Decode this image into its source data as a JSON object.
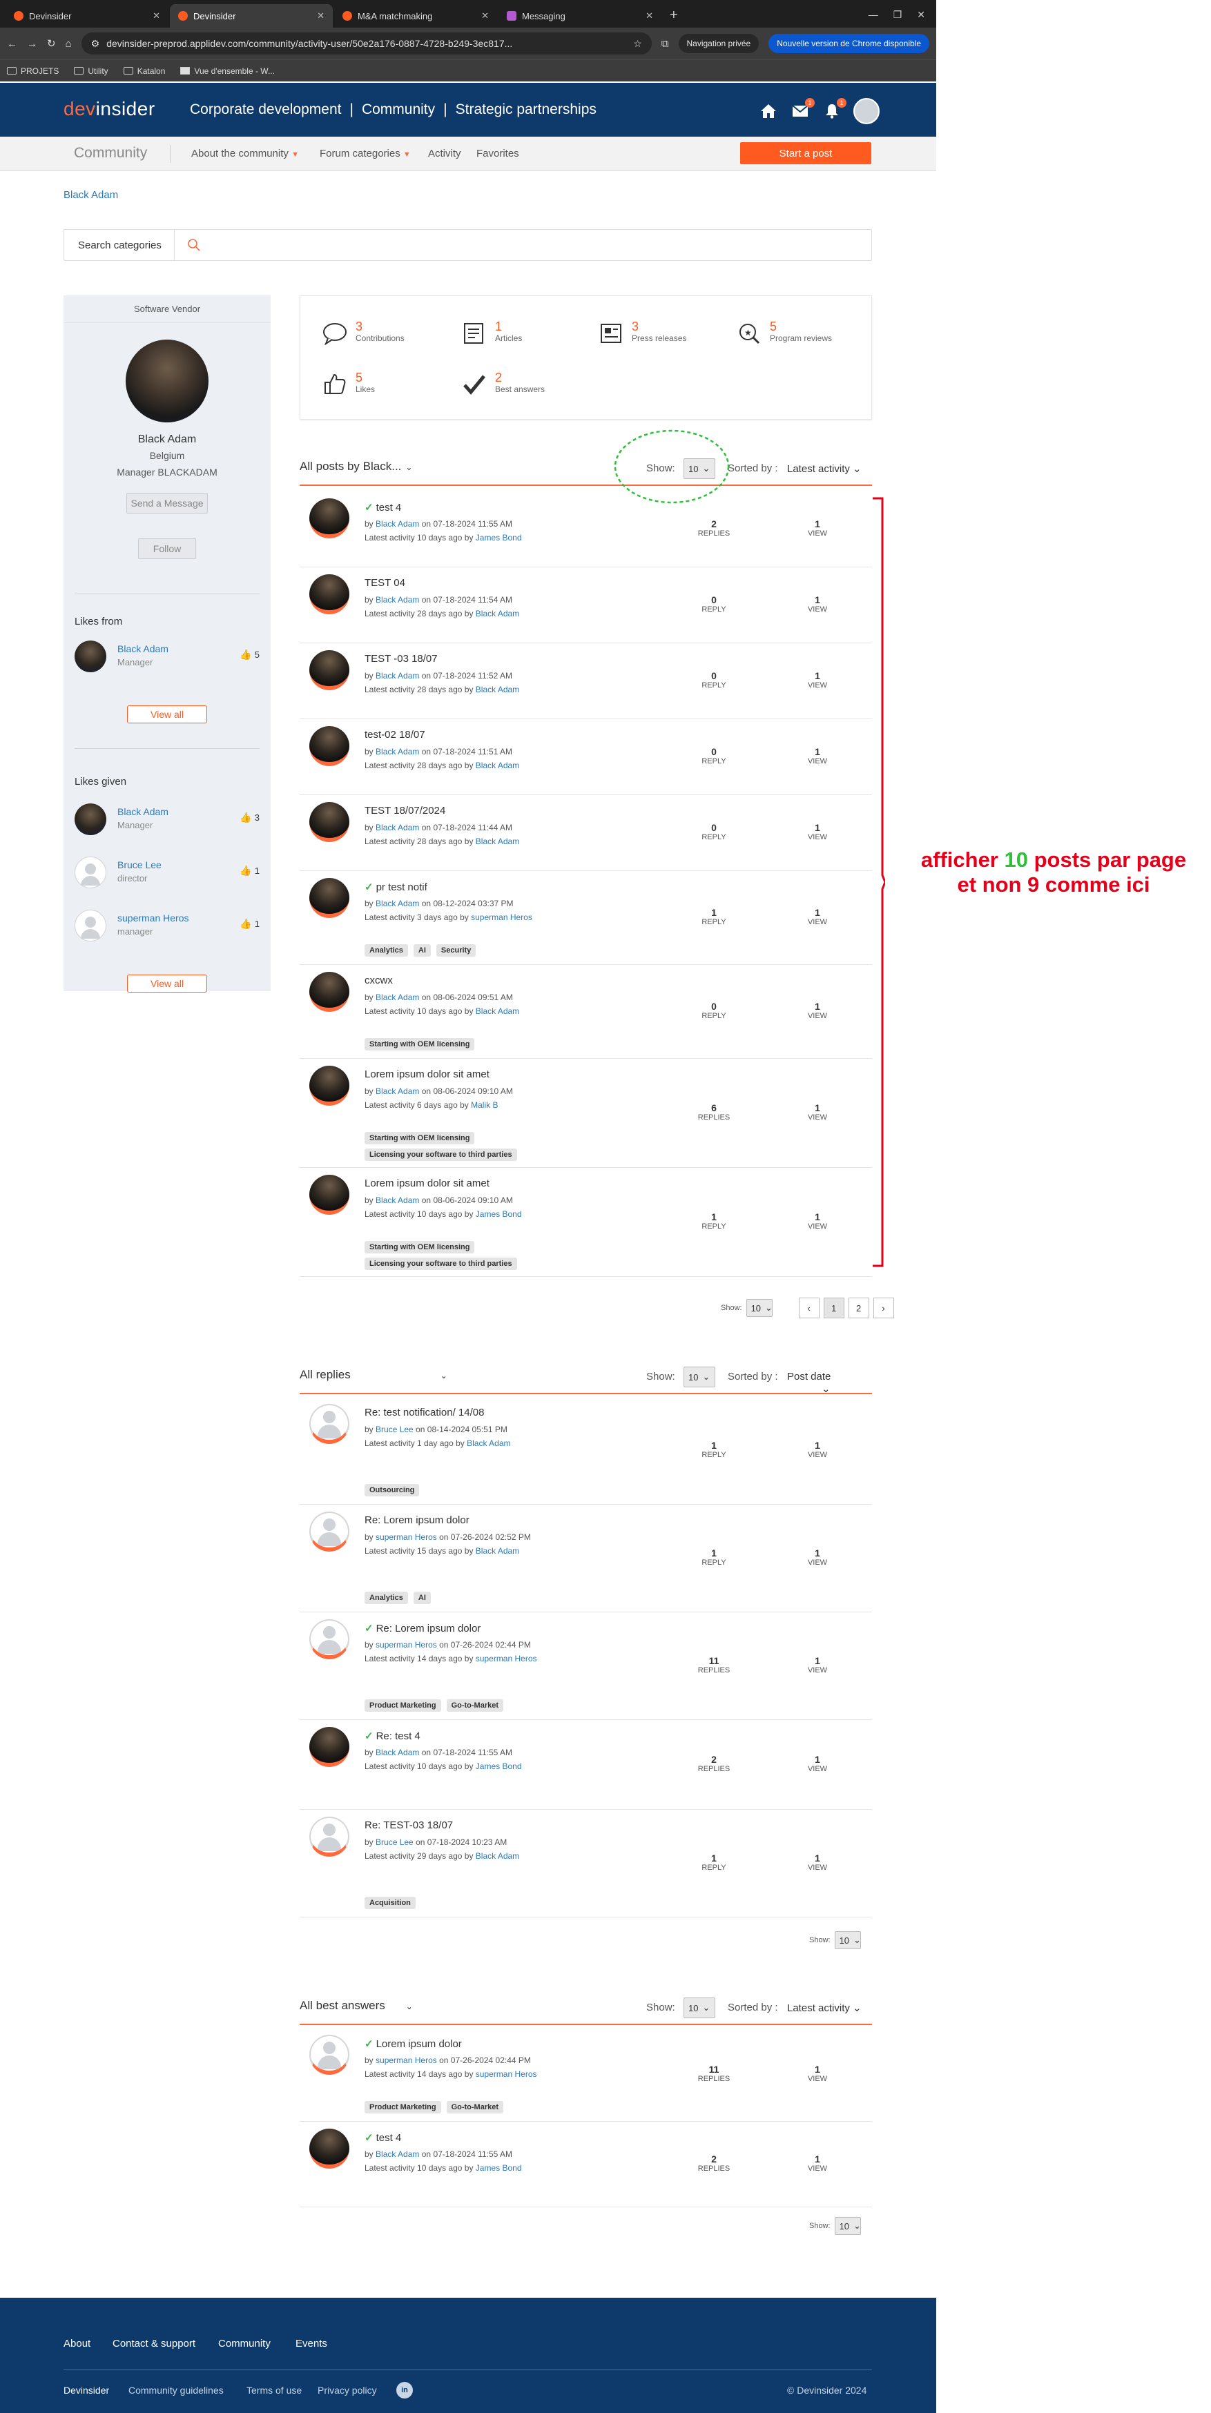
{
  "browser": {
    "tabs": [
      {
        "label": "Devinsider",
        "active": false,
        "icon": "devinsider-favicon"
      },
      {
        "label": "Devinsider",
        "active": true,
        "icon": "devinsider-favicon"
      },
      {
        "label": "M&A matchmaking",
        "active": false,
        "icon": "devinsider-favicon"
      },
      {
        "label": "Messaging",
        "active": false,
        "icon": "messaging-favicon"
      }
    ],
    "url": "devinsider-preprod.applidev.com/community/activity-user/50e2a176-0887-4728-b249-3ec817...",
    "incognito_label": "Navigation privée",
    "update_label": "Nouvelle version de Chrome disponible",
    "bookmarks": [
      "PROJETS",
      "Utility",
      "Katalon",
      "Vue d'ensemble - W..."
    ]
  },
  "header": {
    "logo_dev": "dev",
    "logo_insider": "insider",
    "nav": [
      "Corporate development",
      "Community",
      "Strategic partnerships"
    ],
    "separator": "|",
    "message_badge": "1",
    "notif_badge": "1"
  },
  "subnav": {
    "brand": "Community",
    "items": [
      "About the community",
      "Forum categories",
      "Activity",
      "Favorites"
    ],
    "start_post": "Start a post"
  },
  "breadcrumb": "Black Adam",
  "search": {
    "label": "Search categories"
  },
  "profile": {
    "role_header": "Software Vendor",
    "name": "Black Adam",
    "country": "Belgium",
    "job": "Manager  BLACKADAM",
    "send_message": "Send a Message",
    "follow": "Follow",
    "likes_from_title": "Likes from",
    "likes_from": [
      {
        "name": "Black Adam",
        "role": "Manager",
        "count": "5",
        "avatar": "photo"
      }
    ],
    "view_all": "View all",
    "likes_given_title": "Likes given",
    "likes_given": [
      {
        "name": "Black Adam",
        "role": "Manager",
        "count": "3",
        "avatar": "photo"
      },
      {
        "name": "Bruce Lee",
        "role": "director",
        "count": "1",
        "avatar": "blank"
      },
      {
        "name": "superman Heros",
        "role": "manager",
        "count": "1",
        "avatar": "blank"
      }
    ]
  },
  "stats": [
    {
      "value": "3",
      "label": "Contributions",
      "icon": "comment-icon"
    },
    {
      "value": "1",
      "label": "Articles",
      "icon": "article-icon"
    },
    {
      "value": "3",
      "label": "Press releases",
      "icon": "press-icon"
    },
    {
      "value": "5",
      "label": "Program reviews",
      "icon": "review-icon"
    },
    {
      "value": "5",
      "label": "Likes",
      "icon": "like-icon"
    },
    {
      "value": "2",
      "label": "Best answers",
      "icon": "check-icon"
    }
  ],
  "common": {
    "show": "Show:",
    "show_small": "Show:",
    "sorted_by": "Sorted by :",
    "page_size": "10",
    "by": "by",
    "on": "on",
    "latest": "Latest activity",
    "ago_by": "ago by"
  },
  "posts_section": {
    "title": "All posts by Black...",
    "sort": "Latest activity",
    "pages": [
      "1",
      "2"
    ],
    "items": [
      {
        "title": "test 4",
        "check": true,
        "author": "Black Adam",
        "date": "07-18-2024 11:55 AM",
        "latest": "10 days",
        "last_by": "James Bond",
        "tags": [],
        "replies": "2",
        "replies_label": "REPLIES",
        "views": "1",
        "views_label": "VIEW"
      },
      {
        "title": "TEST 04",
        "check": false,
        "author": "Black Adam",
        "date": "07-18-2024 11:54 AM",
        "latest": "28 days",
        "last_by": "Black Adam",
        "tags": [],
        "replies": "0",
        "replies_label": "REPLY",
        "views": "1",
        "views_label": "VIEW"
      },
      {
        "title": "TEST -03 18/07",
        "check": false,
        "author": "Black Adam",
        "date": "07-18-2024 11:52 AM",
        "latest": "28 days",
        "last_by": "Black Adam",
        "tags": [],
        "replies": "0",
        "replies_label": "REPLY",
        "views": "1",
        "views_label": "VIEW"
      },
      {
        "title": "test-02 18/07",
        "check": false,
        "author": "Black Adam",
        "date": "07-18-2024 11:51 AM",
        "latest": "28 days",
        "last_by": "Black Adam",
        "tags": [],
        "replies": "0",
        "replies_label": "REPLY",
        "views": "1",
        "views_label": "VIEW"
      },
      {
        "title": "TEST 18/07/2024",
        "check": false,
        "author": "Black Adam",
        "date": "07-18-2024 11:44 AM",
        "latest": "28 days",
        "last_by": "Black Adam",
        "tags": [],
        "replies": "0",
        "replies_label": "REPLY",
        "views": "1",
        "views_label": "VIEW"
      },
      {
        "title": "pr test notif",
        "check": true,
        "author": "Black Adam",
        "date": "08-12-2024 03:37 PM",
        "latest": "3 days",
        "last_by": "superman Heros",
        "tags": [
          "Analytics",
          "AI",
          "Security"
        ],
        "replies": "1",
        "replies_label": "REPLY",
        "views": "1",
        "views_label": "VIEW"
      },
      {
        "title": "cxcwx",
        "check": false,
        "author": "Black Adam",
        "date": "08-06-2024 09:51 AM",
        "latest": "10 days",
        "last_by": "Black Adam",
        "tags": [
          "Starting with OEM licensing"
        ],
        "replies": "0",
        "replies_label": "REPLY",
        "views": "1",
        "views_label": "VIEW"
      },
      {
        "title": "Lorem ipsum dolor sit amet",
        "check": false,
        "author": "Black Adam",
        "date": "08-06-2024 09:10 AM",
        "latest": "6 days",
        "last_by": "Malik B",
        "tags": [
          "Starting with OEM licensing",
          "Licensing your software to third parties"
        ],
        "replies": "6",
        "replies_label": "REPLIES",
        "views": "1",
        "views_label": "VIEW"
      },
      {
        "title": "Lorem ipsum dolor sit amet",
        "check": false,
        "author": "Black Adam",
        "date": "08-06-2024 09:10 AM",
        "latest": "10 days",
        "last_by": "James Bond",
        "tags": [
          "Starting with OEM licensing",
          "Licensing your software to third parties"
        ],
        "replies": "1",
        "replies_label": "REPLY",
        "views": "1",
        "views_label": "VIEW"
      }
    ]
  },
  "replies_section": {
    "title": "All replies",
    "sort": "Post date",
    "items": [
      {
        "title": "Re: test notification/ 14/08",
        "check": false,
        "author": "Bruce Lee",
        "date": "08-14-2024 05:51 PM",
        "latest": "1 day",
        "last_by": "Black Adam",
        "tags": [
          "Outsourcing"
        ],
        "replies": "1",
        "replies_label": "REPLY",
        "views": "1",
        "views_label": "VIEW",
        "avatar": "blank"
      },
      {
        "title": "Re: Lorem ipsum dolor",
        "check": false,
        "author": "superman Heros",
        "date": "07-26-2024 02:52 PM",
        "latest": "15 days",
        "last_by": "Black Adam",
        "tags": [
          "Analytics",
          "AI"
        ],
        "replies": "1",
        "replies_label": "REPLY",
        "views": "1",
        "views_label": "VIEW",
        "avatar": "blank"
      },
      {
        "title": "Re: Lorem ipsum dolor",
        "check": true,
        "author": "superman Heros",
        "date": "07-26-2024 02:44 PM",
        "latest": "14 days",
        "last_by": "superman Heros",
        "tags": [
          "Product Marketing",
          "Go-to-Market"
        ],
        "replies": "11",
        "replies_label": "REPLIES",
        "views": "1",
        "views_label": "VIEW",
        "avatar": "blank"
      },
      {
        "title": "Re: test 4",
        "check": true,
        "author": "Black Adam",
        "date": "07-18-2024 11:55 AM",
        "latest": "10 days",
        "last_by": "James Bond",
        "tags": [],
        "replies": "2",
        "replies_label": "REPLIES",
        "views": "1",
        "views_label": "VIEW",
        "avatar": "photo"
      },
      {
        "title": "Re: TEST-03 18/07",
        "check": false,
        "author": "Bruce Lee",
        "date": "07-18-2024 10:23 AM",
        "latest": "29 days",
        "last_by": "Black Adam",
        "tags": [
          "Acquisition"
        ],
        "replies": "1",
        "replies_label": "REPLY",
        "views": "1",
        "views_label": "VIEW",
        "avatar": "blank"
      }
    ]
  },
  "best_section": {
    "title": "All best answers",
    "sort": "Latest activity",
    "items": [
      {
        "title": "Lorem ipsum dolor",
        "check": true,
        "author": "superman Heros",
        "date": "07-26-2024 02:44 PM",
        "latest": "14 days",
        "last_by": "superman Heros",
        "tags": [
          "Product Marketing",
          "Go-to-Market"
        ],
        "replies": "11",
        "replies_label": "REPLIES",
        "views": "1",
        "views_label": "VIEW",
        "avatar": "blank"
      },
      {
        "title": "test 4",
        "check": true,
        "author": "Black Adam",
        "date": "07-18-2024 11:55 AM",
        "latest": "10 days",
        "last_by": "James Bond",
        "tags": [],
        "replies": "2",
        "replies_label": "REPLIES",
        "views": "1",
        "views_label": "VIEW",
        "avatar": "photo"
      }
    ]
  },
  "annotation": {
    "line1_a": "afficher",
    "line1_num": "10",
    "line1_b": "posts par page",
    "line2": "et non 9 comme ici",
    "color_red": "#e3001b",
    "color_green": "#2fbf3a"
  },
  "footer": {
    "links": [
      "About",
      "Contact & support",
      "Community",
      "Events"
    ],
    "brand": "Devinsider",
    "bottom_links": [
      "Community guidelines",
      "Terms of use",
      "Privacy policy"
    ],
    "linkedin": "in",
    "copyright": "© Devinsider 2024"
  },
  "colors": {
    "brand_navy": "#0d3a6a",
    "accent_orange": "#ff5a1f",
    "link_blue": "#2b7ab8"
  }
}
